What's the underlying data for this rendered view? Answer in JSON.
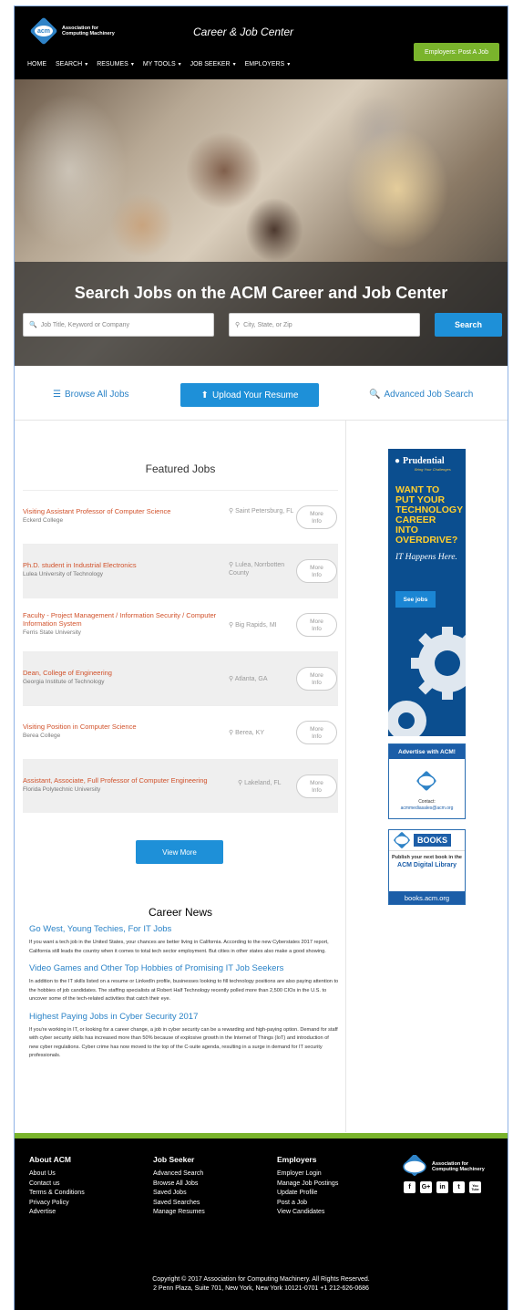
{
  "header": {
    "logo_line1": "Association for",
    "logo_line2": "Computing Machinery",
    "logo_badge": "acm",
    "site_title": "Career & Job Center",
    "post_job": "Employers: Post A Job",
    "nav": [
      "HOME",
      "SEARCH",
      "RESUMES",
      "MY TOOLS",
      "JOB SEEKER",
      "EMPLOYERS"
    ]
  },
  "hero": {
    "title": "Search Jobs on the ACM Career and Job Center",
    "keyword_placeholder": "Job Title, Keyword or Company",
    "location_placeholder": "City, State, or Zip",
    "search_label": "Search"
  },
  "actions": {
    "browse": "Browse All Jobs",
    "upload": "Upload Your Resume",
    "advanced": "Advanced Job Search"
  },
  "featured": {
    "title": "Featured Jobs",
    "more_line1": "More",
    "more_line2": "Info",
    "jobs": [
      {
        "title": "Visiting Assistant Professor of Computer Science",
        "org": "Eckerd College",
        "loc": "Saint Petersburg, FL"
      },
      {
        "title": "Ph.D. student in Industrial Electronics",
        "org": "Lulea University of Technology",
        "loc": "Lulea, Norrbotten County"
      },
      {
        "title": "Faculty - Project Management / Information Security / Computer Information System",
        "org": "Ferris State University",
        "loc": "Big Rapids, MI"
      },
      {
        "title": "Dean, College of Engineering",
        "org": "Georgia Institute of Technology",
        "loc": "Atlanta, GA"
      },
      {
        "title": "Visiting Position in Computer Science",
        "org": "Berea College",
        "loc": "Berea, KY"
      },
      {
        "title": "Assistant, Associate, Full Professor of Computer Engineering",
        "org": "Florida Polytechnic University",
        "loc": "Lakeland, FL"
      }
    ],
    "view_more": "View More"
  },
  "news": {
    "title": "Career News",
    "items": [
      {
        "title": "Go West, Young Techies, For IT Jobs",
        "body": "If you want a tech job in the United States, your chances are better living in California. According to the new Cyberstates 2017 report, California still leads the country when it comes to total tech sector employment. But cities in other states also make a good showing."
      },
      {
        "title": "Video Games and Other Top Hobbies of Promising IT Job Seekers",
        "body": "In addition to the IT skills listed on a resume or LinkedIn profile, businesses looking to fill technology positions are also paying attention to the hobbies of job candidates. The staffing specialists at Robert Half Technology recently polled more than 2,500 CIOs in the U.S. to uncover some of the tech-related activities that catch their eye."
      },
      {
        "title": "Highest Paying Jobs in Cyber Security 2017",
        "body": "If you're working in IT, or looking for a career change, a job in cyber security can be a rewarding and high-paying option. Demand for staff with cyber security skills has increased more than 50% because of explosive growth in the Internet of Things (IoT) and introduction of new cyber regulations. Cyber crime has now moved to the top of the C-suite agenda, resulting in a surge in demand for IT security professionals."
      }
    ]
  },
  "ads": {
    "pru_brand": "Prudential",
    "pru_sub": "Bring Your Challenges",
    "pru_headline": "WANT TO PUT YOUR TECHNOLOGY CAREER INTO OVERDRIVE?",
    "pru_tag": "IT Happens Here.",
    "pru_cta": "See jobs",
    "adv_title": "Advertise with ACM!",
    "adv_contact": "Contact:",
    "adv_email": "acmmediasales@acm.org",
    "books_label": "BOOKS",
    "books_pub": "Publish your next book in the",
    "books_dl": "ACM Digital Library",
    "books_url": "books.acm.org"
  },
  "footer": {
    "about_title": "About ACM",
    "about": [
      "About Us",
      "Contact us",
      "Terms & Conditions",
      "Privacy Policy",
      "Advertise"
    ],
    "seeker_title": "Job Seeker",
    "seeker": [
      "Advanced Search",
      "Browse All Jobs",
      "Saved Jobs",
      "Saved Searches",
      "Manage Resumes"
    ],
    "employers_title": "Employers",
    "employers": [
      "Employer Login",
      "Manage Job Postings",
      "Update Profile",
      "Post a Job",
      "View Candidates"
    ],
    "logo_line1": "Association for",
    "logo_line2": "Computing Machinery",
    "social": [
      "f",
      "G+",
      "in",
      "t",
      "You Tube"
    ],
    "copyright": "Copyright © 2017 Association for Computing Machinery. All Rights Reserved.",
    "address": "2 Penn Plaza, Suite 701, New York, New York 10121-0701 +1 212-626-0686"
  },
  "colors": {
    "accent_blue": "#1e90d8",
    "link_blue": "#2b83c7",
    "job_orange": "#d1512a",
    "brand_green": "#7ab42c"
  }
}
